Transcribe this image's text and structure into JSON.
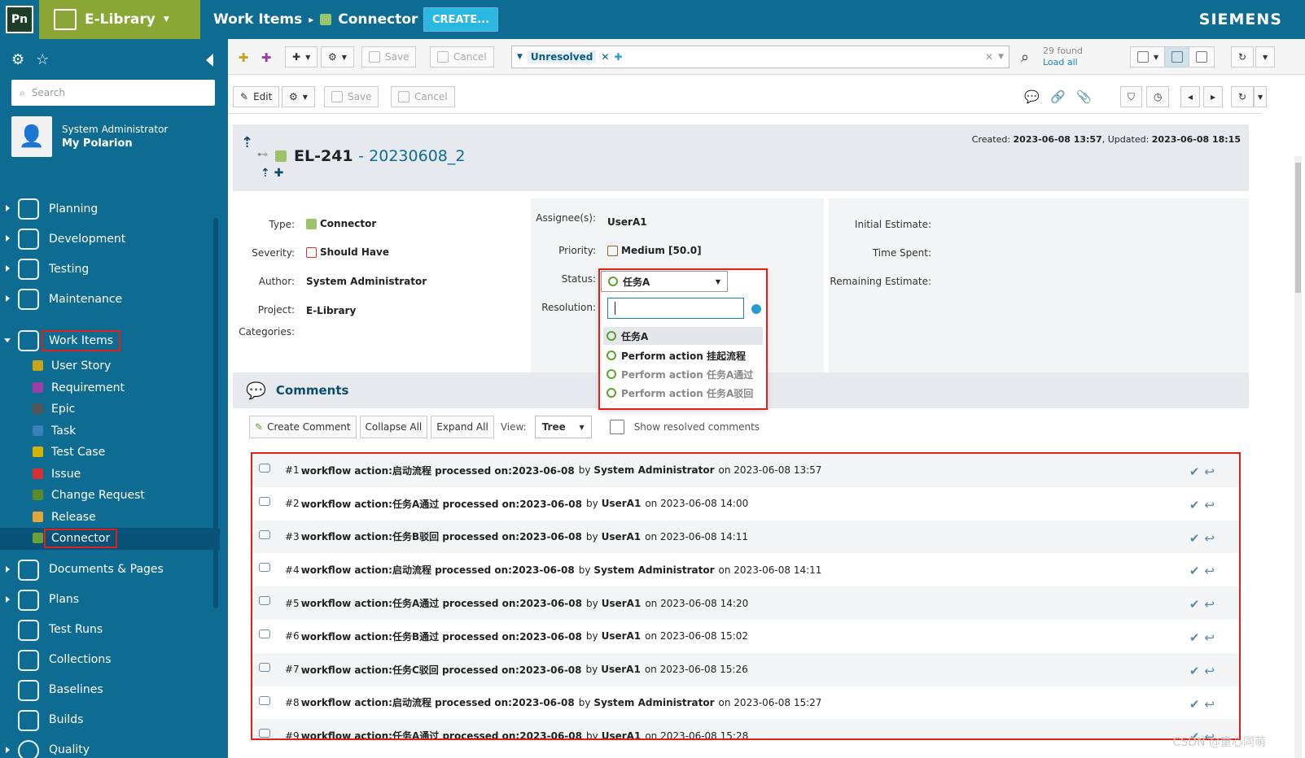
{
  "header": {
    "logo": "Pn",
    "project": "E-Library",
    "crumb1": "Work Items",
    "crumb_sep": "▸",
    "crumb2": "Connector",
    "create": "CREATE...",
    "brand": "SIEMENS"
  },
  "sidebar": {
    "search_placeholder": "Search",
    "user_role": "System Administrator",
    "user_link": "My Polarion",
    "items": [
      {
        "label": "Planning"
      },
      {
        "label": "Development"
      },
      {
        "label": "Testing"
      },
      {
        "label": "Maintenance"
      },
      {
        "label": "Work Items"
      },
      {
        "label": "Documents & Pages"
      },
      {
        "label": "Plans"
      },
      {
        "label": "Test Runs"
      },
      {
        "label": "Collections"
      },
      {
        "label": "Baselines"
      },
      {
        "label": "Builds"
      },
      {
        "label": "Quality"
      }
    ],
    "subitems": [
      {
        "label": "User Story",
        "color": "#c9a21b"
      },
      {
        "label": "Requirement",
        "color": "#9b3fa5"
      },
      {
        "label": "Epic",
        "color": "#555555"
      },
      {
        "label": "Task",
        "color": "#3a7fb8"
      },
      {
        "label": "Test Case",
        "color": "#d4b400"
      },
      {
        "label": "Issue",
        "color": "#d83030"
      },
      {
        "label": "Change Request",
        "color": "#5a8a2a"
      },
      {
        "label": "Release",
        "color": "#e0a83a"
      },
      {
        "label": "Connector",
        "color": "#6aa03a"
      }
    ]
  },
  "toolbar": {
    "save": "Save",
    "cancel": "Cancel",
    "query_tag": "Unresolved",
    "found": "29 found",
    "load_all": "Load all",
    "edit": "Edit",
    "save2": "Save",
    "cancel2": "Cancel"
  },
  "workitem": {
    "id": "EL-241",
    "title": "- 20230608_2",
    "created_label": "Created:",
    "created": "2023-06-08 13:57",
    "updated_label": "Updated:",
    "updated": "2023-06-08 18:15"
  },
  "fields": {
    "type_label": "Type:",
    "type": "Connector",
    "severity_label": "Severity:",
    "severity": "Should Have",
    "author_label": "Author:",
    "author": "System Administrator",
    "project_label": "Project:",
    "project": "E-Library",
    "categories_label": "Categories:",
    "assignee_label": "Assignee(s):",
    "assignee": "UserA1",
    "priority_label": "Priority:",
    "priority": "Medium [50.0]",
    "status_label": "Status:",
    "resolution_label": "Resolution:",
    "initial_label": "Initial Estimate:",
    "spent_label": "Time Spent:",
    "remaining_label": "Remaining Estimate:"
  },
  "status_dropdown": {
    "current": "任务A",
    "options": [
      {
        "label": "任务A"
      },
      {
        "label": "Perform action 挂起流程"
      },
      {
        "label": "Perform action 任务A通过"
      },
      {
        "label": "Perform action 任务A驳回"
      }
    ]
  },
  "comments": {
    "title": "Comments",
    "create": "Create Comment",
    "collapse": "Collapse All",
    "expand": "Expand All",
    "view_label": "View:",
    "view": "Tree",
    "show_resolved": "Show resolved comments",
    "items": [
      {
        "num": "#1",
        "text": "workflow action:启动流程 processed on:2023-06-08",
        "by": "by",
        "author": "System Administrator",
        "on": "on 2023-06-08 13:57"
      },
      {
        "num": "#2",
        "text": "workflow action:任务A通过 processed on:2023-06-08",
        "by": "by",
        "author": "UserA1",
        "on": "on 2023-06-08 14:00"
      },
      {
        "num": "#3",
        "text": "workflow action:任务B驳回 processed on:2023-06-08",
        "by": "by",
        "author": "UserA1",
        "on": "on 2023-06-08 14:11"
      },
      {
        "num": "#4",
        "text": "workflow action:启动流程 processed on:2023-06-08",
        "by": "by",
        "author": "System Administrator",
        "on": "on 2023-06-08 14:11"
      },
      {
        "num": "#5",
        "text": "workflow action:任务A通过 processed on:2023-06-08",
        "by": "by",
        "author": "UserA1",
        "on": "on 2023-06-08 14:20"
      },
      {
        "num": "#6",
        "text": "workflow action:任务B通过 processed on:2023-06-08",
        "by": "by",
        "author": "UserA1",
        "on": "on 2023-06-08 15:02"
      },
      {
        "num": "#7",
        "text": "workflow action:任务C驳回 processed on:2023-06-08",
        "by": "by",
        "author": "UserA1",
        "on": "on 2023-06-08 15:26"
      },
      {
        "num": "#8",
        "text": "workflow action:启动流程 processed on:2023-06-08",
        "by": "by",
        "author": "System Administrator",
        "on": "on 2023-06-08 15:27"
      },
      {
        "num": "#9",
        "text": "workflow action:任务A通过 processed on:2023-06-08",
        "by": "by",
        "author": "UserA1",
        "on": "on 2023-06-08 15:28"
      }
    ]
  },
  "watermark": "CSDN @童心同萌"
}
